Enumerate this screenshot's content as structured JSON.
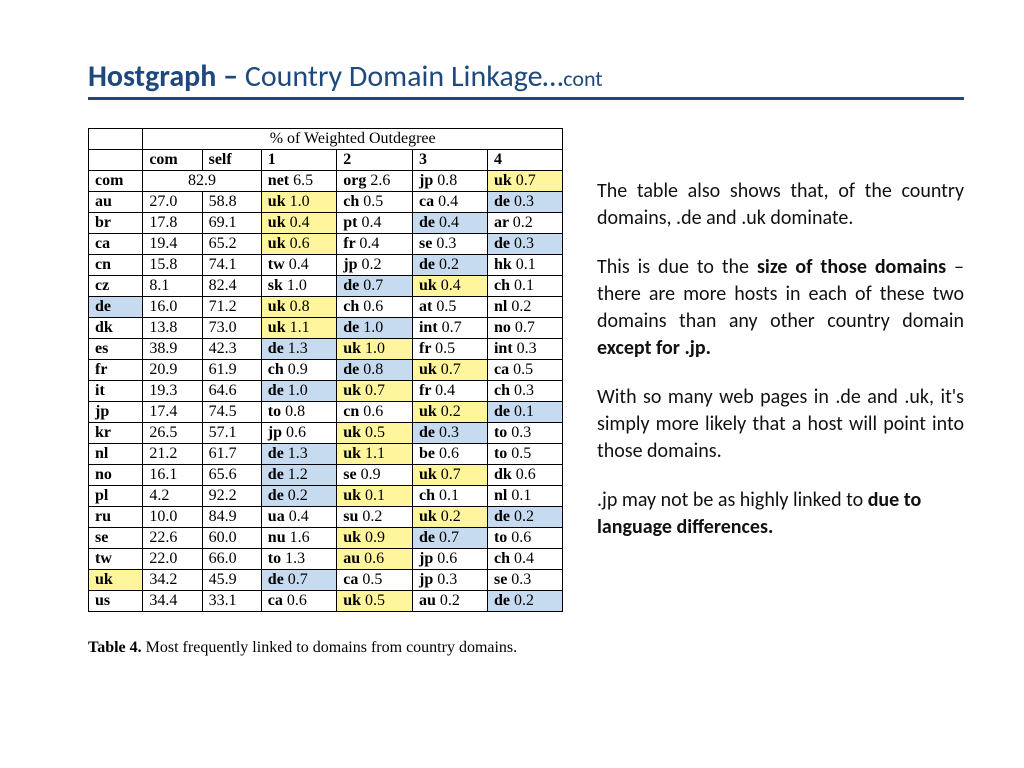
{
  "title": {
    "bold": "Hostgraph – ",
    "rest": "Country Domain Linkage…",
    "cont": "cont"
  },
  "table": {
    "super_header": "% of Weighted Outdegree",
    "cols": [
      "",
      "com",
      "self",
      "1",
      "2",
      "3",
      "4"
    ],
    "rows": [
      {
        "cc": "com",
        "com": "",
        "self": "82.9",
        "self_span": true,
        "c1": {
          "l": "net",
          "v": "6.5"
        },
        "c2": {
          "l": "org",
          "v": "2.6"
        },
        "c3": {
          "l": "jp",
          "v": "0.8"
        },
        "c4": {
          "l": "uk",
          "v": "0.7",
          "hl": "y"
        }
      },
      {
        "cc": "au",
        "com": "27.0",
        "self": "58.8",
        "c1": {
          "l": "uk",
          "v": "1.0",
          "hl": "y"
        },
        "c2": {
          "l": "ch",
          "v": "0.5"
        },
        "c3": {
          "l": "ca",
          "v": "0.4"
        },
        "c4": {
          "l": "de",
          "v": "0.3",
          "hl": "b"
        }
      },
      {
        "cc": "br",
        "com": "17.8",
        "self": "69.1",
        "c1": {
          "l": "uk",
          "v": "0.4",
          "hl": "y"
        },
        "c2": {
          "l": "pt",
          "v": "0.4"
        },
        "c3": {
          "l": "de",
          "v": "0.4",
          "hl": "b"
        },
        "c4": {
          "l": "ar",
          "v": "0.2"
        }
      },
      {
        "cc": "ca",
        "com": "19.4",
        "self": "65.2",
        "c1": {
          "l": "uk",
          "v": "0.6",
          "hl": "y"
        },
        "c2": {
          "l": "fr",
          "v": "0.4"
        },
        "c3": {
          "l": "se",
          "v": "0.3"
        },
        "c4": {
          "l": "de",
          "v": "0.3",
          "hl": "b"
        }
      },
      {
        "cc": "cn",
        "com": "15.8",
        "self": "74.1",
        "c1": {
          "l": "tw",
          "v": "0.4"
        },
        "c2": {
          "l": "jp",
          "v": "0.2"
        },
        "c3": {
          "l": "de",
          "v": "0.2",
          "hl": "b"
        },
        "c4": {
          "l": "hk",
          "v": "0.1"
        }
      },
      {
        "cc": "cz",
        "com": "8.1",
        "self": "82.4",
        "c1": {
          "l": "sk",
          "v": "1.0"
        },
        "c2": {
          "l": "de",
          "v": "0.7",
          "hl": "b"
        },
        "c3": {
          "l": "uk",
          "v": "0.4",
          "hl": "y"
        },
        "c4": {
          "l": "ch",
          "v": "0.1"
        }
      },
      {
        "cc": "de",
        "cc_hl": "b",
        "com": "16.0",
        "self": "71.2",
        "c1": {
          "l": "uk",
          "v": "0.8",
          "hl": "y"
        },
        "c2": {
          "l": "ch",
          "v": "0.6"
        },
        "c3": {
          "l": "at",
          "v": "0.5"
        },
        "c4": {
          "l": "nl",
          "v": "0.2"
        }
      },
      {
        "cc": "dk",
        "com": "13.8",
        "self": "73.0",
        "c1": {
          "l": "uk",
          "v": "1.1",
          "hl": "y"
        },
        "c2": {
          "l": "de",
          "v": "1.0",
          "hl": "b"
        },
        "c3": {
          "l": "int",
          "v": "0.7"
        },
        "c4": {
          "l": "no",
          "v": "0.7"
        }
      },
      {
        "cc": "es",
        "com": "38.9",
        "self": "42.3",
        "c1": {
          "l": "de",
          "v": "1.3",
          "hl": "b"
        },
        "c2": {
          "l": "uk",
          "v": "1.0",
          "hl": "y"
        },
        "c3": {
          "l": "fr",
          "v": "0.5"
        },
        "c4": {
          "l": "int",
          "v": "0.3"
        }
      },
      {
        "cc": "fr",
        "com": "20.9",
        "self": "61.9",
        "c1": {
          "l": "ch",
          "v": "0.9"
        },
        "c2": {
          "l": "de",
          "v": "0.8",
          "hl": "b"
        },
        "c3": {
          "l": "uk",
          "v": "0.7",
          "hl": "y"
        },
        "c4": {
          "l": "ca",
          "v": "0.5"
        }
      },
      {
        "cc": "it",
        "com": "19.3",
        "self": "64.6",
        "c1": {
          "l": "de",
          "v": "1.0",
          "hl": "b"
        },
        "c2": {
          "l": "uk",
          "v": "0.7",
          "hl": "y"
        },
        "c3": {
          "l": "fr",
          "v": "0.4"
        },
        "c4": {
          "l": "ch",
          "v": "0.3"
        }
      },
      {
        "cc": "jp",
        "com": "17.4",
        "self": "74.5",
        "c1": {
          "l": "to",
          "v": "0.8"
        },
        "c2": {
          "l": "cn",
          "v": "0.6"
        },
        "c3": {
          "l": "uk",
          "v": "0.2",
          "hl": "y"
        },
        "c4": {
          "l": "de",
          "v": "0.1",
          "hl": "b"
        }
      },
      {
        "cc": "kr",
        "com": "26.5",
        "self": "57.1",
        "c1": {
          "l": "jp",
          "v": "0.6"
        },
        "c2": {
          "l": "uk",
          "v": "0.5",
          "hl": "y"
        },
        "c3": {
          "l": "de",
          "v": "0.3",
          "hl": "b"
        },
        "c4": {
          "l": "to",
          "v": "0.3"
        }
      },
      {
        "cc": "nl",
        "com": "21.2",
        "self": "61.7",
        "c1": {
          "l": "de",
          "v": "1.3",
          "hl": "b"
        },
        "c2": {
          "l": "uk",
          "v": "1.1",
          "hl": "y"
        },
        "c3": {
          "l": "be",
          "v": "0.6"
        },
        "c4": {
          "l": "to",
          "v": "0.5"
        }
      },
      {
        "cc": "no",
        "com": "16.1",
        "self": "65.6",
        "c1": {
          "l": "de",
          "v": "1.2",
          "hl": "b"
        },
        "c2": {
          "l": "se",
          "v": "0.9"
        },
        "c3": {
          "l": "uk",
          "v": "0.7",
          "hl": "y"
        },
        "c4": {
          "l": "dk",
          "v": "0.6"
        }
      },
      {
        "cc": "pl",
        "com": "4.2",
        "self": "92.2",
        "c1": {
          "l": "de",
          "v": "0.2",
          "hl": "b"
        },
        "c2": {
          "l": "uk",
          "v": "0.1",
          "hl": "y"
        },
        "c3": {
          "l": "ch",
          "v": "0.1"
        },
        "c4": {
          "l": "nl",
          "v": "0.1"
        }
      },
      {
        "cc": "ru",
        "com": "10.0",
        "self": "84.9",
        "c1": {
          "l": "ua",
          "v": "0.4"
        },
        "c2": {
          "l": "su",
          "v": "0.2"
        },
        "c3": {
          "l": "uk",
          "v": "0.2",
          "hl": "y"
        },
        "c4": {
          "l": "de",
          "v": "0.2",
          "hl": "b"
        }
      },
      {
        "cc": "se",
        "com": "22.6",
        "self": "60.0",
        "c1": {
          "l": "nu",
          "v": "1.6"
        },
        "c2": {
          "l": "uk",
          "v": "0.9",
          "hl": "y"
        },
        "c3": {
          "l": "de",
          "v": "0.7",
          "hl": "b"
        },
        "c4": {
          "l": "to",
          "v": "0.6"
        }
      },
      {
        "cc": "tw",
        "com": "22.0",
        "self": "66.0",
        "c1": {
          "l": "to",
          "v": "1.3"
        },
        "c2": {
          "l": "au",
          "v": "0.6",
          "hl": "y"
        },
        "c3": {
          "l": "jp",
          "v": "0.6"
        },
        "c4": {
          "l": "ch",
          "v": "0.4"
        }
      },
      {
        "cc": "uk",
        "cc_hl": "y",
        "com": "34.2",
        "self": "45.9",
        "c1": {
          "l": "de",
          "v": "0.7",
          "hl": "b"
        },
        "c2": {
          "l": "ca",
          "v": "0.5"
        },
        "c3": {
          "l": "jp",
          "v": "0.3"
        },
        "c4": {
          "l": "se",
          "v": "0.3"
        }
      },
      {
        "cc": "us",
        "com": "34.4",
        "self": "33.1",
        "c1": {
          "l": "ca",
          "v": "0.6"
        },
        "c2": {
          "l": "uk",
          "v": "0.5",
          "hl": "y"
        },
        "c3": {
          "l": "au",
          "v": "0.2"
        },
        "c4": {
          "l": "de",
          "v": "0.2",
          "hl": "b"
        }
      }
    ],
    "caption_bold": "Table 4.",
    "caption_rest": " Most frequently linked to domains from country domains."
  },
  "body": {
    "p1a": "The table also shows that, of the country domains, .de and .uk dominate.",
    "p2a": "This is due to the ",
    "p2b": "size of those domains",
    "p2c": " – there are more hosts in each of these two domains than any other country domain ",
    "p2d": "except for .jp.",
    "p3": "With so many web pages in .de and .uk, it's simply more likely that a host will point into those domains.",
    "p4a": ".jp may not be as highly linked to ",
    "p4b": "due to language differences."
  }
}
